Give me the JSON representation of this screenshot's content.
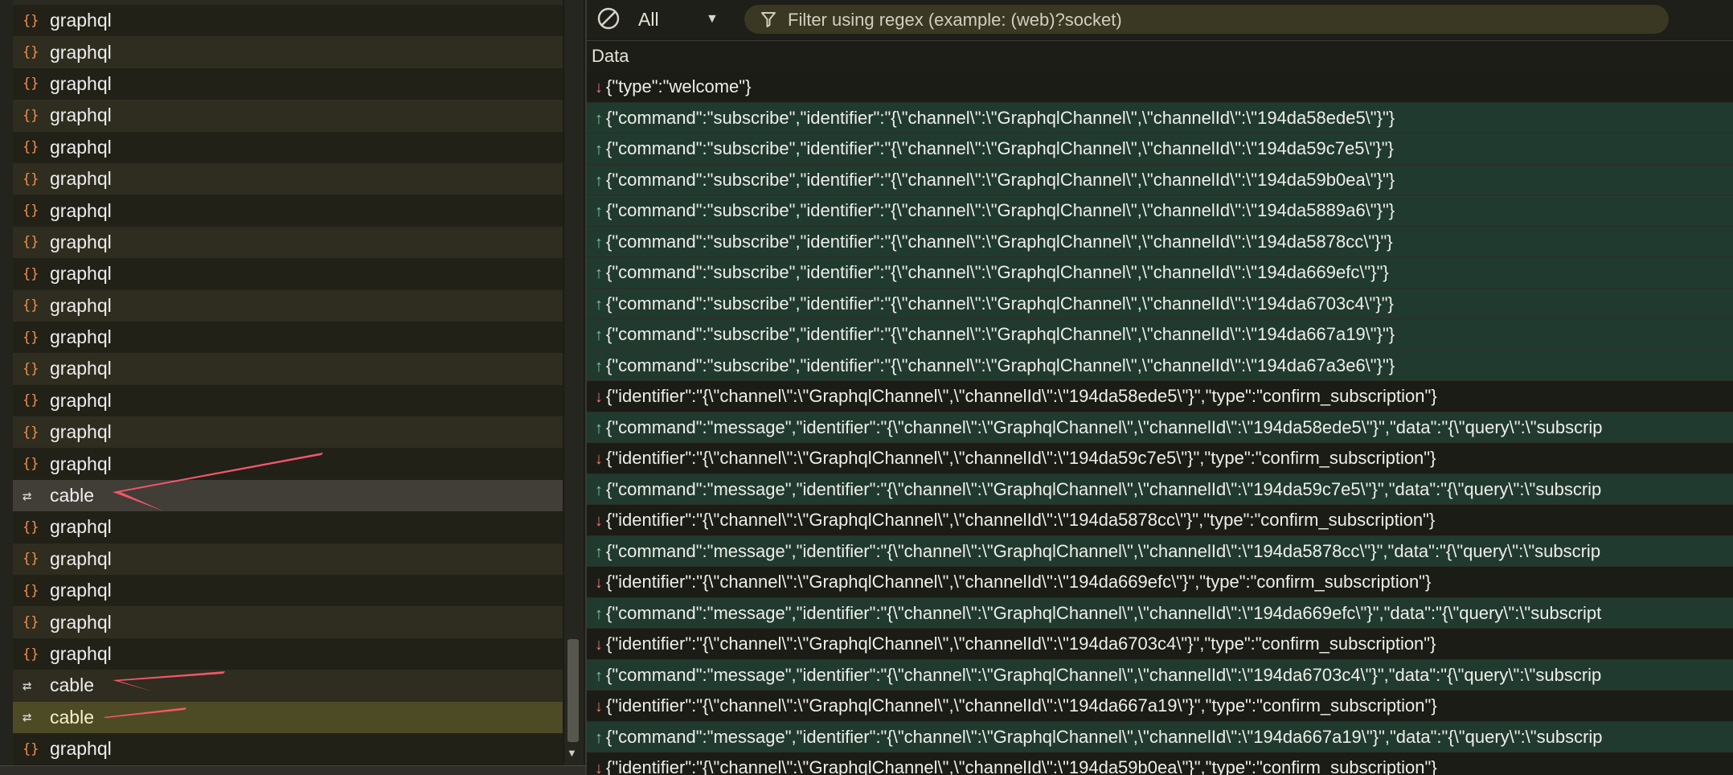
{
  "requests": [
    {
      "name": "graphql",
      "type": "graphql",
      "state": "odd"
    },
    {
      "name": "graphql",
      "type": "graphql",
      "state": "even"
    },
    {
      "name": "graphql",
      "type": "graphql",
      "state": "odd"
    },
    {
      "name": "graphql",
      "type": "graphql",
      "state": "even"
    },
    {
      "name": "graphql",
      "type": "graphql",
      "state": "odd"
    },
    {
      "name": "graphql",
      "type": "graphql",
      "state": "even"
    },
    {
      "name": "graphql",
      "type": "graphql",
      "state": "odd"
    },
    {
      "name": "graphql",
      "type": "graphql",
      "state": "even"
    },
    {
      "name": "graphql",
      "type": "graphql",
      "state": "odd"
    },
    {
      "name": "graphql",
      "type": "graphql",
      "state": "even"
    },
    {
      "name": "graphql",
      "type": "graphql",
      "state": "odd"
    },
    {
      "name": "graphql",
      "type": "graphql",
      "state": "even"
    },
    {
      "name": "graphql",
      "type": "graphql",
      "state": "odd"
    },
    {
      "name": "graphql",
      "type": "graphql",
      "state": "even"
    },
    {
      "name": "graphql",
      "type": "graphql",
      "state": "odd"
    },
    {
      "name": "cable",
      "type": "websocket",
      "state": "cable-sel"
    },
    {
      "name": "graphql",
      "type": "graphql",
      "state": "odd"
    },
    {
      "name": "graphql",
      "type": "graphql",
      "state": "even"
    },
    {
      "name": "graphql",
      "type": "graphql",
      "state": "odd"
    },
    {
      "name": "graphql",
      "type": "graphql",
      "state": "even"
    },
    {
      "name": "graphql",
      "type": "graphql",
      "state": "odd"
    },
    {
      "name": "cable",
      "type": "websocket",
      "state": "even"
    },
    {
      "name": "cable",
      "type": "websocket",
      "state": "cable-hi"
    },
    {
      "name": "graphql",
      "type": "graphql",
      "state": "odd"
    }
  ],
  "icons": {
    "graphql": "{}",
    "websocket": "⇄"
  },
  "toolbar": {
    "filter_type": "All",
    "filter_placeholder": "Filter using regex (example: (web)?socket)"
  },
  "messages_header": "Data",
  "messages": [
    {
      "dir": "recv",
      "text": "{\"type\":\"welcome\"}"
    },
    {
      "dir": "sent",
      "text": "{\"command\":\"subscribe\",\"identifier\":\"{\\\"channel\\\":\\\"GraphqlChannel\\\",\\\"channelId\\\":\\\"194da58ede5\\\"}\"}"
    },
    {
      "dir": "sent",
      "text": "{\"command\":\"subscribe\",\"identifier\":\"{\\\"channel\\\":\\\"GraphqlChannel\\\",\\\"channelId\\\":\\\"194da59c7e5\\\"}\"}"
    },
    {
      "dir": "sent",
      "text": "{\"command\":\"subscribe\",\"identifier\":\"{\\\"channel\\\":\\\"GraphqlChannel\\\",\\\"channelId\\\":\\\"194da59b0ea\\\"}\"}"
    },
    {
      "dir": "sent",
      "text": "{\"command\":\"subscribe\",\"identifier\":\"{\\\"channel\\\":\\\"GraphqlChannel\\\",\\\"channelId\\\":\\\"194da5889a6\\\"}\"}"
    },
    {
      "dir": "sent",
      "text": "{\"command\":\"subscribe\",\"identifier\":\"{\\\"channel\\\":\\\"GraphqlChannel\\\",\\\"channelId\\\":\\\"194da5878cc\\\"}\"}"
    },
    {
      "dir": "sent",
      "text": "{\"command\":\"subscribe\",\"identifier\":\"{\\\"channel\\\":\\\"GraphqlChannel\\\",\\\"channelId\\\":\\\"194da669efc\\\"}\"}"
    },
    {
      "dir": "sent",
      "text": "{\"command\":\"subscribe\",\"identifier\":\"{\\\"channel\\\":\\\"GraphqlChannel\\\",\\\"channelId\\\":\\\"194da6703c4\\\"}\"}"
    },
    {
      "dir": "sent",
      "text": "{\"command\":\"subscribe\",\"identifier\":\"{\\\"channel\\\":\\\"GraphqlChannel\\\",\\\"channelId\\\":\\\"194da667a19\\\"}\"}"
    },
    {
      "dir": "sent",
      "text": "{\"command\":\"subscribe\",\"identifier\":\"{\\\"channel\\\":\\\"GraphqlChannel\\\",\\\"channelId\\\":\\\"194da67a3e6\\\"}\"}"
    },
    {
      "dir": "recv",
      "text": "{\"identifier\":\"{\\\"channel\\\":\\\"GraphqlChannel\\\",\\\"channelId\\\":\\\"194da58ede5\\\"}\",\"type\":\"confirm_subscription\"}"
    },
    {
      "dir": "sent",
      "text": "{\"command\":\"message\",\"identifier\":\"{\\\"channel\\\":\\\"GraphqlChannel\\\",\\\"channelId\\\":\\\"194da58ede5\\\"}\",\"data\":\"{\\\"query\\\":\\\"subscrip"
    },
    {
      "dir": "recv",
      "text": "{\"identifier\":\"{\\\"channel\\\":\\\"GraphqlChannel\\\",\\\"channelId\\\":\\\"194da59c7e5\\\"}\",\"type\":\"confirm_subscription\"}"
    },
    {
      "dir": "sent",
      "text": "{\"command\":\"message\",\"identifier\":\"{\\\"channel\\\":\\\"GraphqlChannel\\\",\\\"channelId\\\":\\\"194da59c7e5\\\"}\",\"data\":\"{\\\"query\\\":\\\"subscrip"
    },
    {
      "dir": "recv",
      "text": "{\"identifier\":\"{\\\"channel\\\":\\\"GraphqlChannel\\\",\\\"channelId\\\":\\\"194da5878cc\\\"}\",\"type\":\"confirm_subscription\"}"
    },
    {
      "dir": "sent",
      "text": "{\"command\":\"message\",\"identifier\":\"{\\\"channel\\\":\\\"GraphqlChannel\\\",\\\"channelId\\\":\\\"194da5878cc\\\"}\",\"data\":\"{\\\"query\\\":\\\"subscrip"
    },
    {
      "dir": "recv",
      "text": "{\"identifier\":\"{\\\"channel\\\":\\\"GraphqlChannel\\\",\\\"channelId\\\":\\\"194da669efc\\\"}\",\"type\":\"confirm_subscription\"}"
    },
    {
      "dir": "sent",
      "text": "{\"command\":\"message\",\"identifier\":\"{\\\"channel\\\":\\\"GraphqlChannel\\\",\\\"channelId\\\":\\\"194da669efc\\\"}\",\"data\":\"{\\\"query\\\":\\\"subscript"
    },
    {
      "dir": "recv",
      "text": "{\"identifier\":\"{\\\"channel\\\":\\\"GraphqlChannel\\\",\\\"channelId\\\":\\\"194da6703c4\\\"}\",\"type\":\"confirm_subscription\"}"
    },
    {
      "dir": "sent",
      "text": "{\"command\":\"message\",\"identifier\":\"{\\\"channel\\\":\\\"GraphqlChannel\\\",\\\"channelId\\\":\\\"194da6703c4\\\"}\",\"data\":\"{\\\"query\\\":\\\"subscrip"
    },
    {
      "dir": "recv",
      "text": "{\"identifier\":\"{\\\"channel\\\":\\\"GraphqlChannel\\\",\\\"channelId\\\":\\\"194da667a19\\\"}\",\"type\":\"confirm_subscription\"}"
    },
    {
      "dir": "sent",
      "text": "{\"command\":\"message\",\"identifier\":\"{\\\"channel\\\":\\\"GraphqlChannel\\\",\\\"channelId\\\":\\\"194da667a19\\\"}\",\"data\":\"{\\\"query\\\":\\\"subscrip"
    },
    {
      "dir": "recv",
      "text": "{\"identifier\":\"{\\\"channel\\\":\\\"GraphqlChannel\\\",\\\"channelId\\\":\\\"194da59b0ea\\\"}\",\"type\":\"confirm_subscription\"}"
    }
  ],
  "direction_icons": {
    "sent": "↑",
    "recv": "↓"
  },
  "colors": {
    "annotation_arrow": "#f4566a",
    "sent_row": "#213a2f",
    "graphql_icon": "#f08f4f"
  }
}
